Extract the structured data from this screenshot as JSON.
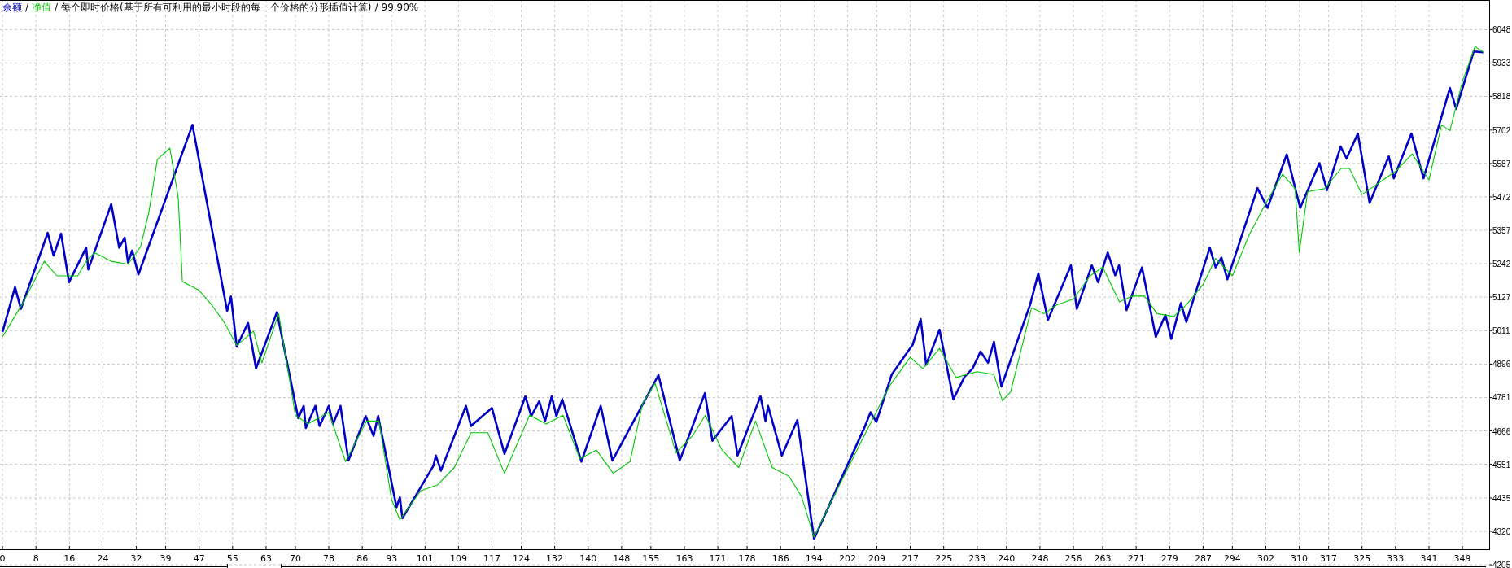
{
  "header": {
    "separators": [
      "/",
      "/",
      "/"
    ],
    "model": "每个即时价格(基于所有可利用的最小时段的每一个价格的分形插值计算)",
    "quality": "99.90%"
  },
  "chart_data": {
    "type": "line",
    "grid": true,
    "xlim": [
      -0.6,
      355.4
    ],
    "ylim": [
      4205,
      6150
    ],
    "xticks": [
      0,
      8,
      16,
      24,
      32,
      39,
      47,
      55,
      63,
      70,
      78,
      86,
      93,
      101,
      109,
      117,
      124,
      132,
      140,
      148,
      155,
      163,
      171,
      178,
      186,
      194,
      202,
      209,
      217,
      225,
      233,
      240,
      248,
      256,
      263,
      271,
      279,
      287,
      294,
      302,
      310,
      317,
      325,
      333,
      341,
      349
    ],
    "yticks": [
      4205,
      4320,
      4435,
      4551,
      4666,
      4781,
      4896,
      5011,
      5127,
      5242,
      5357,
      5472,
      5587,
      5702,
      5818,
      5933,
      6048
    ],
    "series": [
      {
        "name": "余额",
        "color": "#0000c8",
        "x": [
          0,
          3,
          4.4,
          10.8,
          12.2,
          14,
          15.9,
          20,
          20.5,
          26,
          27.9,
          29.2,
          30,
          31,
          32.5,
          45.4,
          53.7,
          54.6,
          56,
          58.7,
          60.6,
          65.6,
          70.7,
          72,
          72.5,
          74.8,
          75.8,
          78,
          79,
          80.8,
          82.7,
          86.8,
          88.7,
          89.8,
          94.2,
          95,
          95.6,
          103,
          103.6,
          104.8,
          110.8,
          112,
          117,
          120,
          125,
          126.4,
          128.3,
          129.7,
          131.3,
          132.4,
          133.8,
          138.4,
          143,
          145.8,
          156.8,
          161.9,
          167.9,
          169.7,
          174.3,
          175.7,
          181.2,
          182.4,
          183,
          186.3,
          190,
          194,
          206,
          207.5,
          208.9,
          212.6,
          217.6,
          219.5,
          220.8,
          224,
          227.3,
          230,
          231.9,
          233.8,
          235.6,
          237,
          238.8,
          245.7,
          247.6,
          249.9,
          255.4,
          256.8,
          260.4,
          261.9,
          264.2,
          266,
          266.9,
          268.7,
          272.4,
          275.7,
          278,
          279.4,
          281.7,
          283,
          288.6,
          290,
          291.4,
          292.8,
          300,
          302.4,
          307,
          310.2,
          314.8,
          316.6,
          319.9,
          321.3,
          324,
          326.8,
          331.4,
          332.6,
          336.8,
          339.7,
          346,
          347.5,
          351.7,
          354
        ],
        "values": [
          5007,
          5161,
          5086,
          5348,
          5270,
          5345,
          5178,
          5297,
          5222,
          5447,
          5297,
          5331,
          5246,
          5287,
          5205,
          5720,
          5079,
          5129,
          4956,
          5038,
          4881,
          5075,
          4710,
          4752,
          4676,
          4752,
          4683,
          4752,
          4690,
          4752,
          4564,
          4717,
          4649,
          4717,
          4403,
          4437,
          4365,
          4546,
          4581,
          4529,
          4752,
          4683,
          4745,
          4587,
          4785,
          4717,
          4768,
          4700,
          4785,
          4717,
          4775,
          4560,
          4752,
          4564,
          4858,
          4564,
          4796,
          4632,
          4717,
          4581,
          4785,
          4700,
          4752,
          4581,
          4703,
          4294,
          4676,
          4730,
          4697,
          4861,
          4963,
          5051,
          4894,
          5014,
          4775,
          4853,
          4881,
          4939,
          4901,
          4973,
          4819,
          5103,
          5208,
          5048,
          5236,
          5086,
          5236,
          5178,
          5280,
          5202,
          5236,
          5082,
          5229,
          4990,
          5065,
          4983,
          5106,
          5041,
          5297,
          5229,
          5263,
          5188,
          5502,
          5434,
          5618,
          5434,
          5588,
          5495,
          5645,
          5604,
          5690,
          5451,
          5611,
          5536,
          5690,
          5536,
          5847,
          5775,
          5973,
          5970
        ]
      },
      {
        "name": "净值",
        "color": "#00c800",
        "x": [
          0,
          5,
          10,
          13,
          18,
          20,
          22,
          26,
          30,
          33,
          35,
          37,
          40,
          42,
          43,
          47,
          50,
          53,
          56,
          60,
          62,
          66,
          70,
          73,
          78,
          82,
          87,
          90,
          93,
          95,
          100,
          104,
          108,
          112,
          116,
          120,
          126,
          130,
          134,
          138,
          142,
          146,
          150,
          153,
          156,
          161,
          165,
          168,
          172,
          176,
          180,
          184,
          188,
          191,
          194,
          198,
          206,
          212,
          217,
          220,
          224,
          228,
          233,
          237,
          239,
          241,
          246,
          249,
          252,
          256,
          260,
          263,
          267,
          270,
          273,
          276,
          280,
          283,
          287,
          290,
          294,
          298,
          302,
          306,
          309,
          310,
          312,
          316,
          320,
          322,
          325,
          329,
          333,
          337,
          341,
          344,
          346,
          349,
          352,
          354
        ],
        "values": [
          4990,
          5110,
          5250,
          5200,
          5200,
          5250,
          5280,
          5250,
          5240,
          5300,
          5420,
          5600,
          5640,
          5470,
          5180,
          5150,
          5100,
          5040,
          4960,
          5010,
          4900,
          5070,
          4720,
          4690,
          4730,
          4560,
          4700,
          4700,
          4430,
          4360,
          4460,
          4480,
          4540,
          4660,
          4660,
          4520,
          4720,
          4690,
          4720,
          4570,
          4600,
          4520,
          4560,
          4760,
          4830,
          4590,
          4650,
          4720,
          4600,
          4540,
          4700,
          4540,
          4510,
          4440,
          4300,
          4420,
          4650,
          4820,
          4920,
          4880,
          4950,
          4850,
          4870,
          4860,
          4770,
          4800,
          5090,
          5070,
          5100,
          5120,
          5200,
          5230,
          5110,
          5130,
          5130,
          5070,
          5060,
          5100,
          5170,
          5260,
          5200,
          5340,
          5450,
          5550,
          5500,
          5280,
          5490,
          5500,
          5570,
          5570,
          5480,
          5520,
          5560,
          5620,
          5530,
          5720,
          5700,
          5870,
          5990,
          5970
        ]
      }
    ]
  }
}
